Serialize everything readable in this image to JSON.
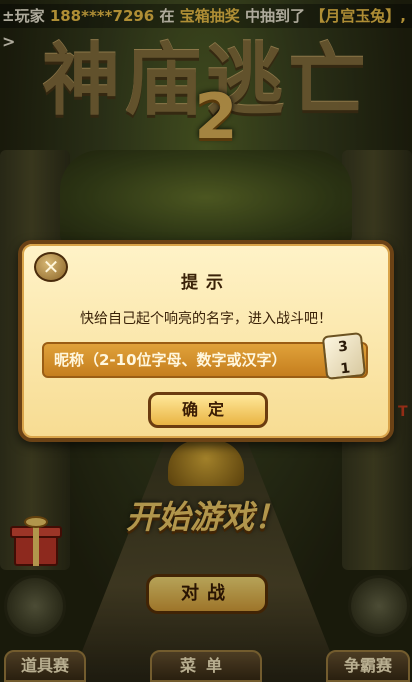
{
  "marquee": {
    "prefix": "±玩家",
    "phone": "188****7296",
    "mid": "在",
    "source": "宝箱抽奖",
    "mid2": "中抽到了",
    "prize": "【月宫玉兔】,"
  },
  "nav_arrow": ">",
  "logo": {
    "title": "神庙逃亡",
    "number": "2"
  },
  "dialog": {
    "close_symbol": "✕",
    "title": "提示",
    "message": "快给自己起个响亮的名字，进入战斗吧！",
    "input_placeholder": "昵称（2-10位字母、数字或汉字）",
    "dice_top": "3",
    "dice_bottom": "1",
    "confirm_label": "确定"
  },
  "start_label": "开始游戏！",
  "battle_label": "对战",
  "bottom_nav": {
    "items_label": "道具赛",
    "menu_label": "菜单",
    "rank_label": "争霸赛"
  },
  "side_letter": "T",
  "colors": {
    "accent_gold": "#f3c54a",
    "dialog_bg": "#fff3c8",
    "input_bg": "#e0a23a"
  }
}
